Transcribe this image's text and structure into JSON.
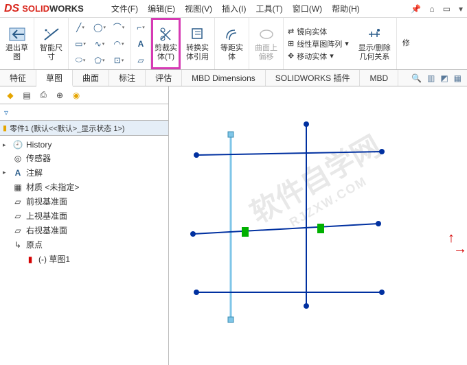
{
  "title": {
    "brand_ds": "DS",
    "brand_bold": "SOLID",
    "brand_rest": "WORKS"
  },
  "menu": [
    "文件(F)",
    "编辑(E)",
    "视图(V)",
    "插入(I)",
    "工具(T)",
    "窗口(W)",
    "帮助(H)"
  ],
  "ribbon": {
    "exit_sketch": "退出草\n图",
    "smart_dim": "智能尺\n寸",
    "trim": "剪裁实\n体(T)",
    "convert": "转换实\n体引用",
    "offset": "等距实\n体",
    "onface": "曲面上\n偏移",
    "mirror": "镜向实体",
    "linear": "线性草图阵列",
    "move": "移动实体",
    "show_rel": "显示/删除\n几何关系",
    "repair": "修"
  },
  "tabs": [
    "特征",
    "草图",
    "曲面",
    "标注",
    "评估",
    "MBD Dimensions",
    "SOLIDWORKS 插件",
    "MBD"
  ],
  "part_name": "零件1 (默认<<默认>_显示状态 1>)",
  "tree": {
    "history": "History",
    "sensors": "传感器",
    "annotations": "注解",
    "material": "材质 <未指定>",
    "front": "前视基准面",
    "top": "上视基准面",
    "right": "右视基准面",
    "origin": "原点",
    "sketch1": "(-) 草图1"
  },
  "watermark": {
    "main": "软件自学网",
    "sub": "RJZXW.COM"
  }
}
